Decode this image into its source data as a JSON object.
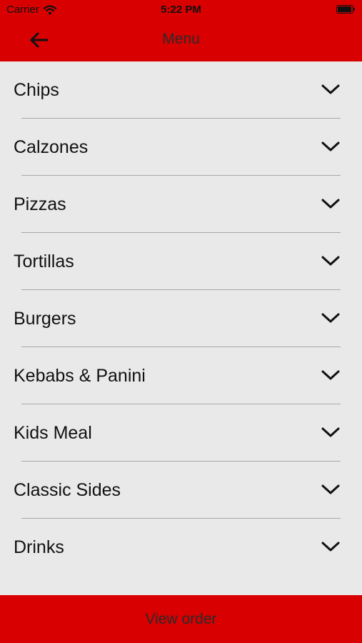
{
  "status_bar": {
    "carrier": "Carrier",
    "time": "5:22 PM",
    "wifi_icon": "wifi-icon",
    "battery_icon": "battery-icon"
  },
  "header": {
    "title": "Menu",
    "back_icon": "arrow-left-icon",
    "background_color": "#d80000"
  },
  "menu": {
    "expand_icon": "chevron-down-icon",
    "items": [
      {
        "label": "Chips"
      },
      {
        "label": "Calzones"
      },
      {
        "label": "Pizzas"
      },
      {
        "label": "Tortillas"
      },
      {
        "label": "Burgers"
      },
      {
        "label": "Kebabs & Panini"
      },
      {
        "label": "Kids Meal"
      },
      {
        "label": "Classic Sides"
      },
      {
        "label": "Drinks"
      }
    ]
  },
  "footer": {
    "button_label": "View order",
    "background_color": "#d80000"
  }
}
